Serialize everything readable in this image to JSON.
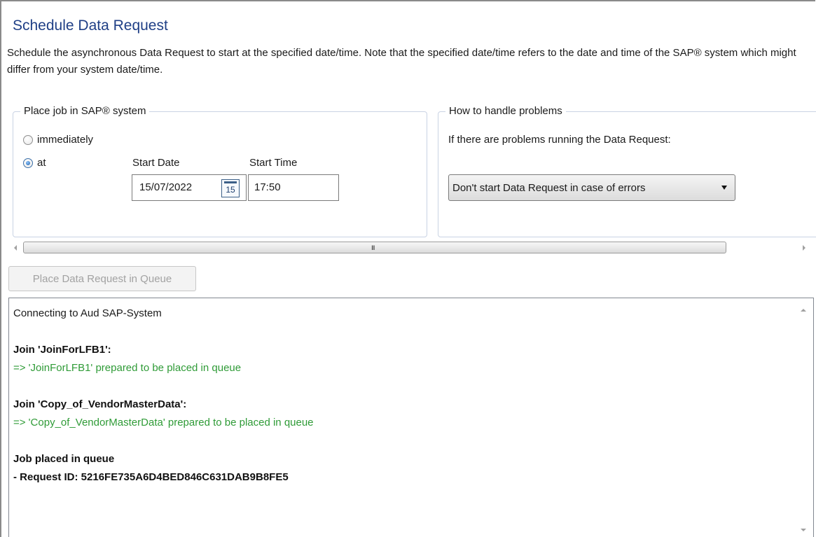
{
  "header": {
    "title": "Schedule Data Request",
    "description": "Schedule the asynchronous Data Request to start at the specified date/time. Note that the specified date/time refers to the date and time of the SAP® system which might differ from your system date/time."
  },
  "place_job": {
    "legend": "Place job in SAP® system",
    "options": [
      {
        "label": "immediately",
        "checked": false
      },
      {
        "label": "at",
        "checked": true
      }
    ],
    "start_date_label": "Start Date",
    "start_date_value": "15/07/2022",
    "calendar_day": "15",
    "start_time_label": "Start Time",
    "start_time_value": "17:50"
  },
  "problems": {
    "legend": "How to handle problems",
    "prompt": "If there are problems running the Data Request:",
    "selected_option": "Don't start Data Request in case of errors"
  },
  "scrollbar": {
    "grip": "III"
  },
  "queue_button": {
    "label": "Place Data Request in Queue",
    "enabled": false
  },
  "log": {
    "lines": [
      {
        "text": "Connecting to Aud SAP-System",
        "style": "normal"
      },
      {
        "text": "",
        "style": "normal"
      },
      {
        "text": "Join 'JoinForLFB1':",
        "style": "bold"
      },
      {
        "text": "=> 'JoinForLFB1' prepared to be placed in queue",
        "style": "green"
      },
      {
        "text": "",
        "style": "normal"
      },
      {
        "text": "Join 'Copy_of_VendorMasterData':",
        "style": "bold"
      },
      {
        "text": "=> 'Copy_of_VendorMasterData' prepared to be placed in queue",
        "style": "green"
      },
      {
        "text": "",
        "style": "normal"
      },
      {
        "text": "Job placed in queue",
        "style": "bold"
      },
      {
        "text": "- Request ID: 5216FE735A6D4BED846C631DAB9B8FE5",
        "style": "bold"
      }
    ]
  },
  "colors": {
    "title": "#1f3f86",
    "success_text": "#2f9b37",
    "group_border": "#c9d3e4"
  }
}
